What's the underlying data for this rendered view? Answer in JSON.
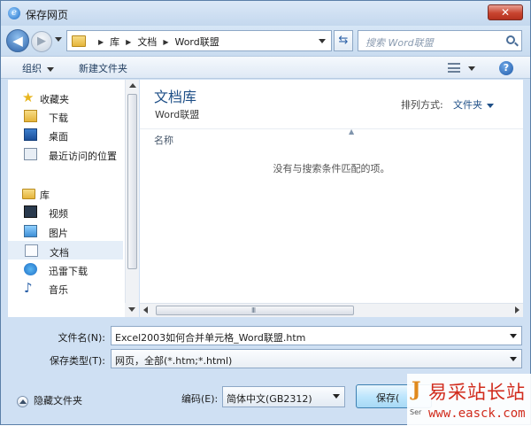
{
  "window": {
    "title": "保存网页",
    "close_label": "✕"
  },
  "address": {
    "crumbs": [
      "库",
      "文档",
      "Word联盟"
    ],
    "search_placeholder": "搜索 Word联盟"
  },
  "toolbar": {
    "organize": "组织",
    "new_folder": "新建文件夹"
  },
  "nav": {
    "favorites": "收藏夹",
    "downloads": "下载",
    "desktop": "桌面",
    "recent": "最近访问的位置",
    "libraries": "库",
    "videos": "视频",
    "pictures": "图片",
    "documents": "文档",
    "thunder": "迅雷下载",
    "music": "音乐"
  },
  "content": {
    "library_title": "文档库",
    "library_sub": "Word联盟",
    "sort_label": "排列方式:",
    "sort_value": "文件夹",
    "column_name": "名称",
    "empty_message": "没有与搜索条件匹配的项。"
  },
  "form": {
    "filename_label": "文件名(N):",
    "filename_value": "Excel2003如何合并单元格_Word联盟.htm",
    "filetype_label": "保存类型(T):",
    "filetype_value": "网页，全部(*.htm;*.html)",
    "hide_folders": "隐藏文件夹",
    "encoding_label": "编码(E):",
    "encoding_value": "简体中文(GB2312)",
    "save_button": "保存("
  },
  "watermark": {
    "text": "易采站长站",
    "url": "www.easck.com"
  }
}
